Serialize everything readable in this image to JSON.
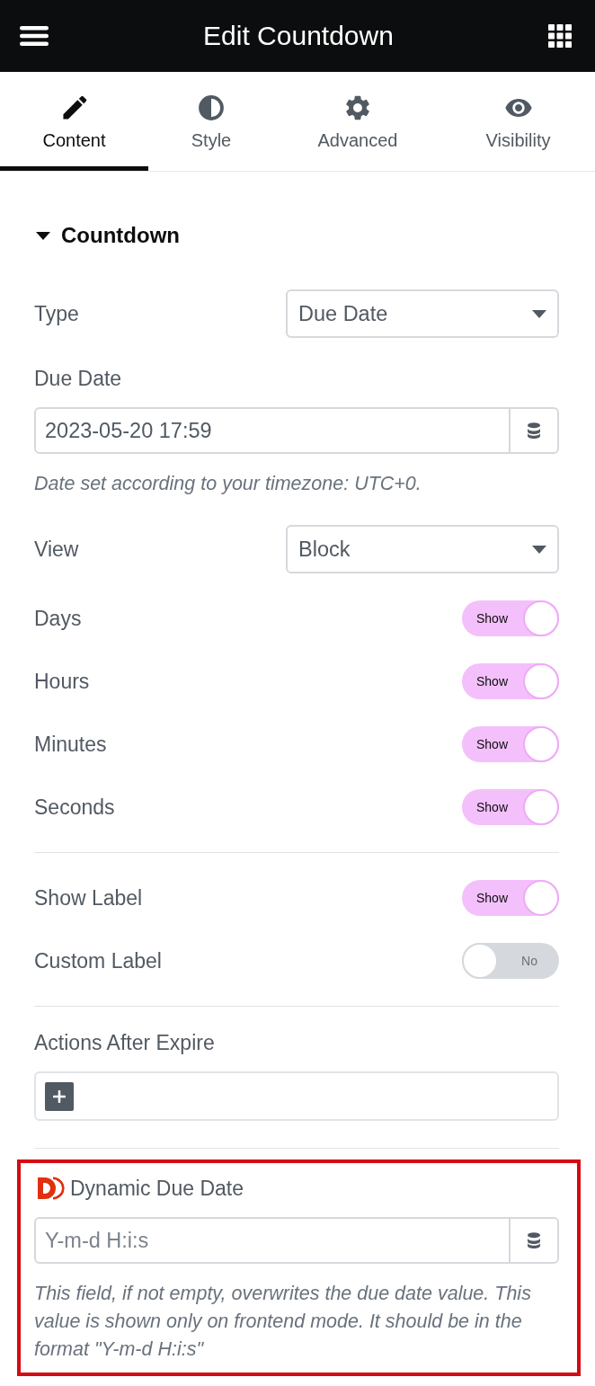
{
  "header": {
    "title": "Edit Countdown"
  },
  "tabs": [
    {
      "label": "Content",
      "selected": true
    },
    {
      "label": "Style",
      "selected": false
    },
    {
      "label": "Advanced",
      "selected": false
    },
    {
      "label": "Visibility",
      "selected": false
    }
  ],
  "section": {
    "title": "Countdown",
    "expanded": true,
    "groups": [
      {
        "highlighted": false,
        "controls": [
          {
            "kind": "select",
            "label": "Type",
            "value": "Due Date"
          },
          {
            "kind": "input",
            "label": "Due Date",
            "value": "2023-05-20 17:59",
            "help": "Date set according to your timezone: UTC+0."
          },
          {
            "kind": "select",
            "label": "View",
            "value": "Block"
          },
          {
            "kind": "switch",
            "label": "Days",
            "on": true,
            "text": "Show"
          },
          {
            "kind": "switch",
            "label": "Hours",
            "on": true,
            "text": "Show"
          },
          {
            "kind": "switch",
            "label": "Minutes",
            "on": true,
            "text": "Show"
          },
          {
            "kind": "switch",
            "label": "Seconds",
            "on": true,
            "text": "Show"
          }
        ]
      },
      {
        "highlighted": false,
        "controls": [
          {
            "kind": "switch",
            "label": "Show Label",
            "on": true,
            "text": "Show"
          },
          {
            "kind": "switch",
            "label": "Custom Label",
            "on": false,
            "text": "No"
          }
        ]
      },
      {
        "highlighted": false,
        "controls": [
          {
            "kind": "repeater",
            "label": "Actions After Expire"
          }
        ]
      },
      {
        "highlighted": true,
        "controls": [
          {
            "kind": "input",
            "label": "Dynamic Due Date",
            "logo": true,
            "placeholder": "Y-m-d H:i:s",
            "help": "This field, if not empty, overwrites the due date value. This value is shown only on frontend mode. It should be in the format \"Y-m-d H:i:s\""
          }
        ]
      }
    ]
  }
}
